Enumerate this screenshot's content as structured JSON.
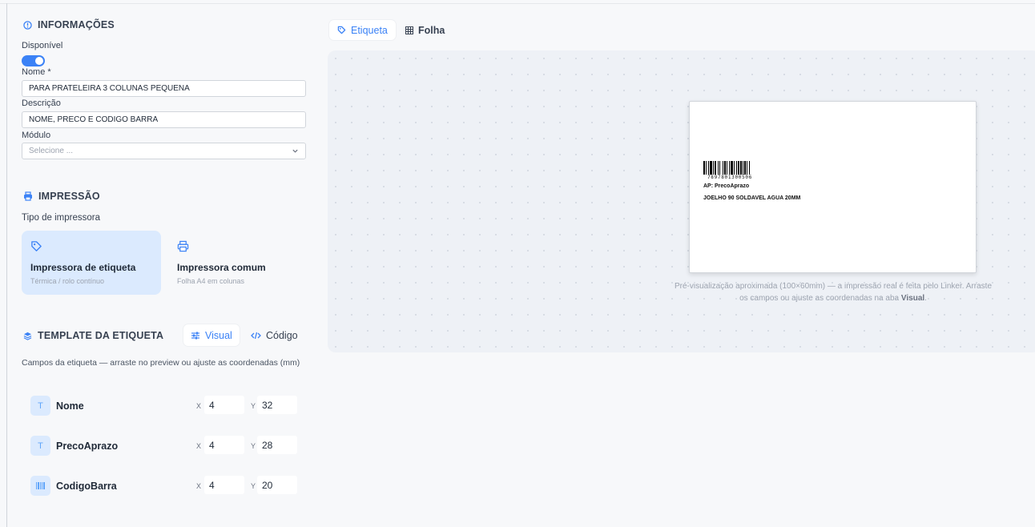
{
  "info": {
    "title": "INFORMAÇÕES",
    "available_label": "Disponível",
    "available": true,
    "name_label": "Nome *",
    "name_value": "PARA PRATELEIRA 3 COLUNAS PEQUENA",
    "description_label": "Descrição",
    "description_value": "NOME, PRECO E CODIGO BARRA",
    "module_label": "Módulo",
    "module_placeholder": "Selecione ..."
  },
  "printing": {
    "title": "IMPRESSÃO",
    "printer_type_label": "Tipo de impressora",
    "options": [
      {
        "title": "Impressora de etiqueta",
        "subtitle": "Térmica / rolo contínuo",
        "icon": "tag-icon",
        "selected": true
      },
      {
        "title": "Impressora comum",
        "subtitle": "Folha A4 em colunas",
        "icon": "printer-icon",
        "selected": false
      }
    ]
  },
  "template": {
    "title": "TEMPLATE DA ETIQUETA",
    "tabs": [
      {
        "label": "Visual",
        "icon": "sliders-icon",
        "active": true
      },
      {
        "label": "Código",
        "icon": "code-icon",
        "active": false
      }
    ],
    "fields_description": "Campos da etiqueta — arraste no preview ou ajuste as coordenadas (mm)",
    "x_label": "X",
    "y_label": "Y",
    "fields": [
      {
        "name": "Nome",
        "icon": "text-icon",
        "badge": "T",
        "x": "4",
        "y": "32"
      },
      {
        "name": "PrecoAprazo",
        "icon": "text-icon",
        "badge": "T",
        "x": "4",
        "y": "28"
      },
      {
        "name": "CodigoBarra",
        "icon": "barcode-icon",
        "badge": "",
        "x": "4",
        "y": "20"
      }
    ]
  },
  "preview": {
    "tabs": [
      {
        "label": "Etiqueta",
        "icon": "tag-icon",
        "active": true
      },
      {
        "label": "Folha",
        "icon": "grid-icon",
        "active": false
      }
    ],
    "label": {
      "barcode_number": "7897801300506",
      "price_line": "AP: PrecoAprazo",
      "name_line": "JOELHO 90 SOLDAVEL AGUA 20MM"
    },
    "caption_main": "Pré-visualização aproximada (100×60mm) — a impressão real é feita pelo Linker. Arraste os campos ou ajuste as coordenadas na aba",
    "caption_bold": "Visual",
    "caption_end": "."
  },
  "colors": {
    "accent": "#3b82f6",
    "selected_card": "#dbeafe",
    "preview_bg": "#eef1f6"
  }
}
